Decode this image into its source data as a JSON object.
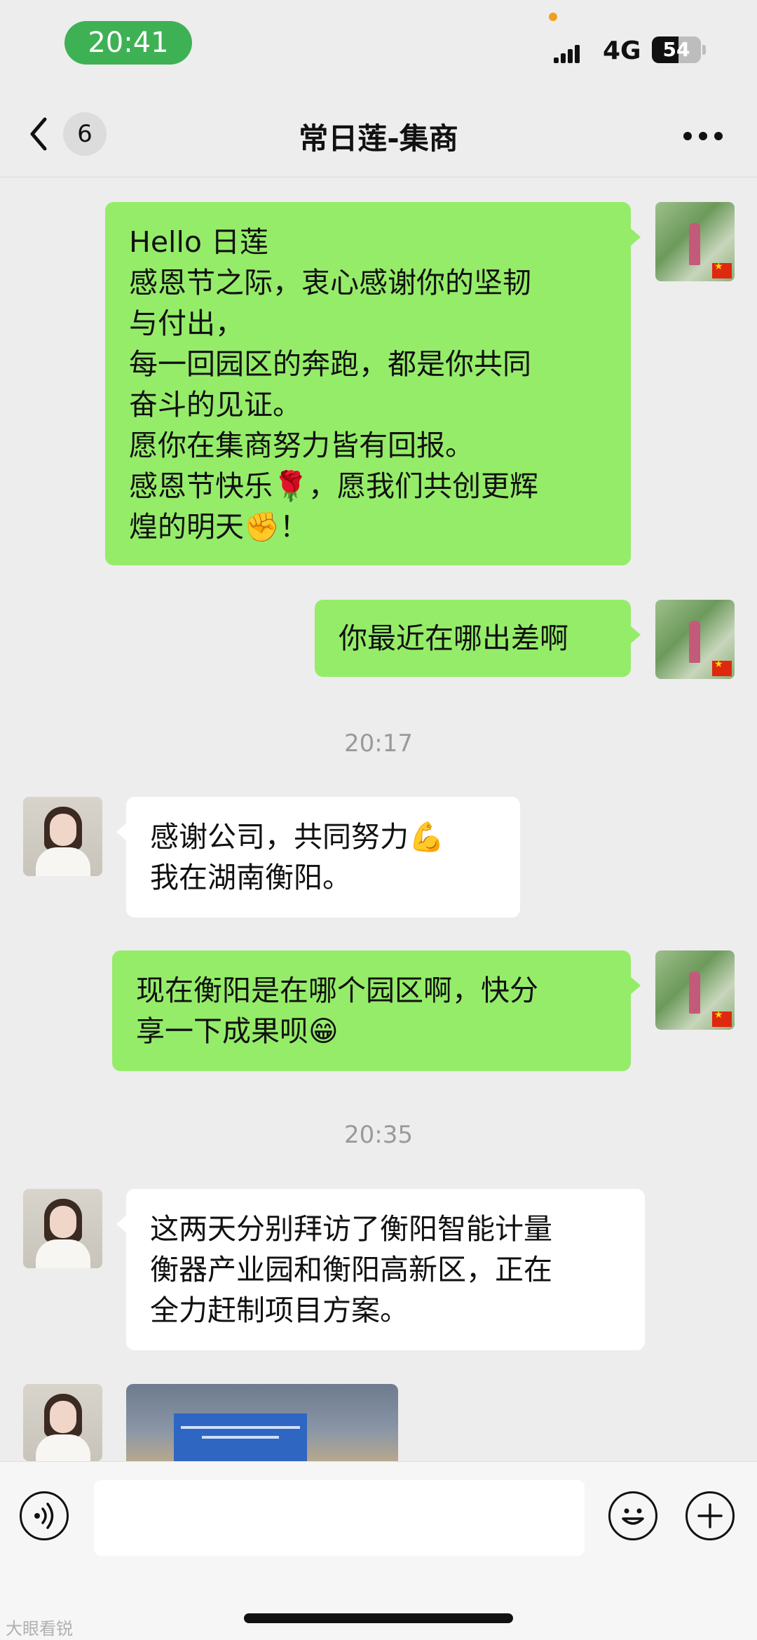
{
  "status_bar": {
    "time": "20:41",
    "network": "4G",
    "battery_text": "54",
    "battery_level": 0.54
  },
  "nav": {
    "back_icon": "chevron-left-icon",
    "unread_count": "6",
    "title": "常日莲-集商",
    "more_icon": "more-horizontal-icon"
  },
  "messages": [
    {
      "sender": "me",
      "text": "Hello 日莲\n感恩节之际，衷心感谢你的坚韧\n与付出，\n每一回园区的奔跑，都是你共同\n奋斗的见证。\n愿你在集商努力皆有回报。\n感恩节快乐🌹，愿我们共创更辉\n煌的明天✊！"
    },
    {
      "sender": "me",
      "text": "你最近在哪出差啊"
    },
    {
      "type": "timestamp",
      "text": "20:17"
    },
    {
      "sender": "her",
      "text": "感谢公司，共同努力💪\n我在湖南衡阳。"
    },
    {
      "sender": "me",
      "text": "现在衡阳是在哪个园区啊，快分\n享一下成果呗😁"
    },
    {
      "type": "timestamp",
      "text": "20:35"
    },
    {
      "sender": "her",
      "text": "这两天分别拜访了衡阳智能计量\n衡器产业园和衡阳高新区，正在\n全力赶制项目方案。"
    },
    {
      "sender": "her",
      "type": "image"
    }
  ],
  "input_bar": {
    "voice_icon": "voice-icon",
    "emoji_icon": "emoji-icon",
    "plus_icon": "plus-icon",
    "placeholder": ""
  },
  "watermark": "大眼看锐"
}
